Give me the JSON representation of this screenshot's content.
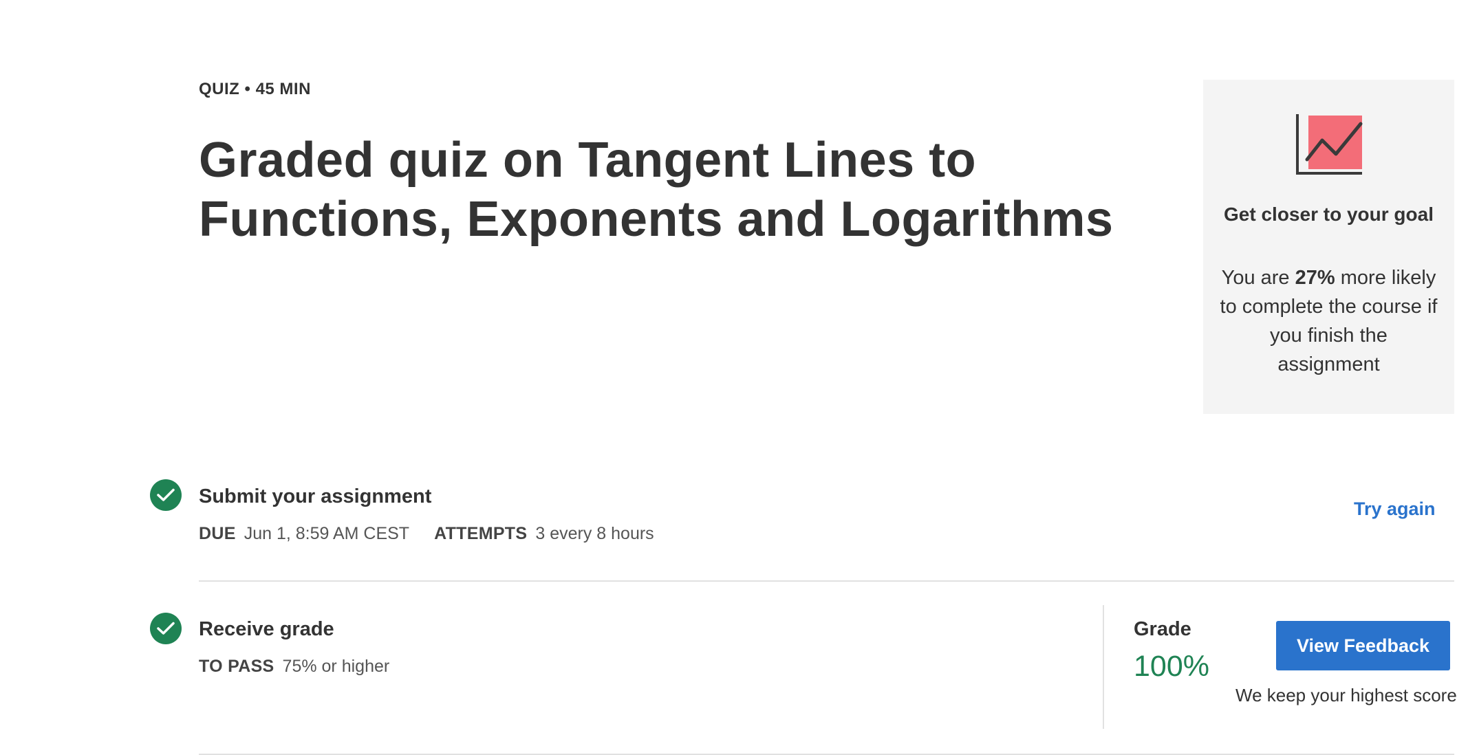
{
  "header": {
    "kicker": "QUIZ • 45 MIN",
    "title": "Graded quiz on Tangent Lines to Functions, Exponents and Logarithms"
  },
  "goal_card": {
    "icon": "chart-line-icon",
    "heading": "Get closer to your goal",
    "text_before": "You are",
    "percent": "27%",
    "text_after": "more likely to complete the course if you finish the assignment",
    "accent_color": "#f36d78"
  },
  "submit_step": {
    "status_icon": "check-circle-icon",
    "title": "Submit your assignment",
    "due_label": "DUE",
    "due_value": "Jun 1, 8:59 AM CEST",
    "attempts_label": "ATTEMPTS",
    "attempts_value": "3 every 8 hours",
    "action_label": "Try again"
  },
  "grade_step": {
    "status_icon": "check-circle-icon",
    "title": "Receive grade",
    "pass_label": "TO PASS",
    "pass_value": "75% or higher",
    "grade_label": "Grade",
    "grade_value": "100%",
    "button_label": "View Feedback",
    "note": "We keep your highest score"
  },
  "colors": {
    "success": "#1f8354",
    "link": "#2a73cc",
    "card_bg": "#f4f4f4"
  }
}
